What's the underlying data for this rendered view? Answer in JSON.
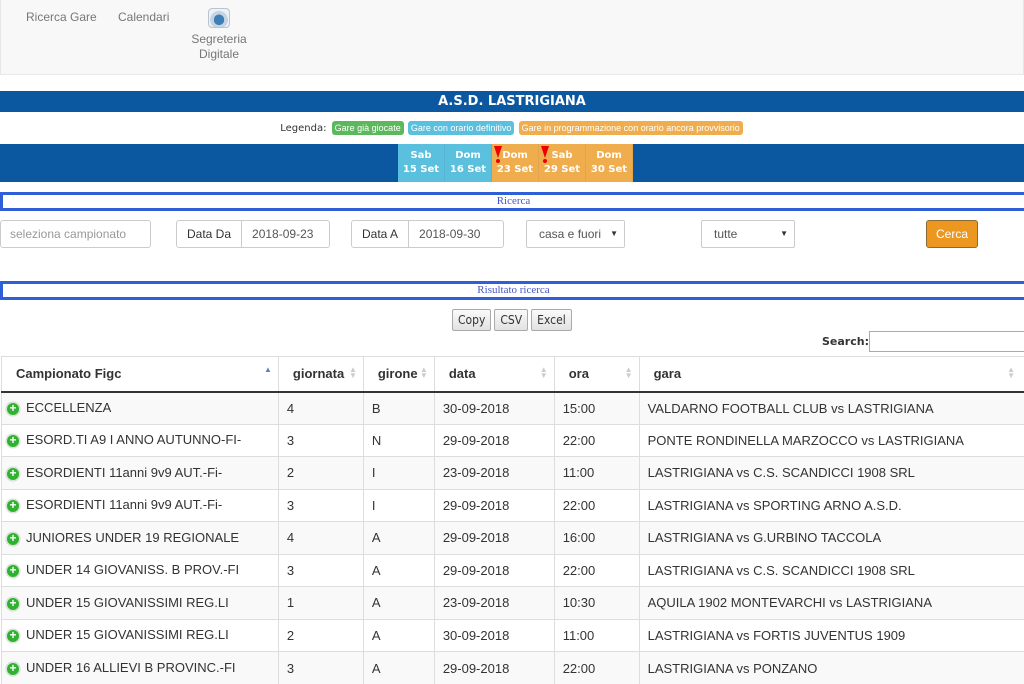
{
  "nav": {
    "ricerca_gare": "Ricerca Gare",
    "calendari": "Calendari",
    "segreteria_line1": "Segreteria",
    "segreteria_line2": "Digitale"
  },
  "title": "A.S.D. LASTRIGIANA",
  "legend": {
    "label": "Legenda:",
    "played": "Gare già giocate",
    "definitive": "Gare con orario definitivo",
    "provisional": "Gare in programmazione con orario ancora provvisorio",
    "colors": {
      "played": "#5cb85c",
      "definitive": "#5bc0de",
      "provisional": "#f0ad4e"
    }
  },
  "days": [
    {
      "day": "Sab",
      "date": "15 Set",
      "status": "definitive",
      "warning": false
    },
    {
      "day": "Dom",
      "date": "16 Set",
      "status": "definitive",
      "warning": false
    },
    {
      "day": "Dom",
      "date": "23 Set",
      "status": "provisional",
      "warning": true
    },
    {
      "day": "Sab",
      "date": "29 Set",
      "status": "provisional",
      "warning": true
    },
    {
      "day": "Dom",
      "date": "30 Set",
      "status": "provisional",
      "warning": false
    }
  ],
  "search": {
    "section_title": "Ricerca",
    "campionato_placeholder": "seleziona campionato",
    "data_da_label": "Data Da",
    "data_da_value": "2018-09-23",
    "data_a_label": "Data A",
    "data_a_value": "2018-09-30",
    "location_select": "casa e fuori",
    "type_select": "tutte",
    "submit": "Cerca"
  },
  "results": {
    "section_title": "Risultato ricerca",
    "export_buttons": [
      "Copy",
      "CSV",
      "Excel"
    ],
    "search_label": "Search:",
    "search_value": "",
    "columns": [
      "Campionato Figc",
      "giornata",
      "girone",
      "data",
      "ora",
      "gara"
    ],
    "rows": [
      [
        "ECCELLENZA",
        "4",
        "B",
        "30-09-2018",
        "15:00",
        "VALDARNO FOOTBALL CLUB vs LASTRIGIANA"
      ],
      [
        "ESORD.TI A9 I ANNO AUTUNNO-FI-",
        "3",
        "N",
        "29-09-2018",
        "22:00",
        "PONTE RONDINELLA MARZOCCO vs LASTRIGIANA"
      ],
      [
        "ESORDIENTI 11anni 9v9 AUT.-Fi-",
        "2",
        "I",
        "23-09-2018",
        "11:00",
        "LASTRIGIANA vs C.S. SCANDICCI 1908 SRL"
      ],
      [
        "ESORDIENTI 11anni 9v9 AUT.-Fi-",
        "3",
        "I",
        "29-09-2018",
        "22:00",
        "LASTRIGIANA vs SPORTING ARNO A.S.D."
      ],
      [
        "JUNIORES UNDER 19 REGIONALE",
        "4",
        "A",
        "29-09-2018",
        "16:00",
        "LASTRIGIANA vs G.URBINO TACCOLA"
      ],
      [
        "UNDER 14 GIOVANISS. B PROV.-FI",
        "3",
        "A",
        "29-09-2018",
        "22:00",
        "LASTRIGIANA vs C.S. SCANDICCI 1908 SRL"
      ],
      [
        "UNDER 15 GIOVANISSIMI REG.LI",
        "1",
        "A",
        "23-09-2018",
        "10:30",
        "AQUILA 1902 MONTEVARCHI vs LASTRIGIANA"
      ],
      [
        "UNDER 15 GIOVANISSIMI REG.LI",
        "2",
        "A",
        "30-09-2018",
        "11:00",
        "LASTRIGIANA vs FORTIS JUVENTUS 1909"
      ],
      [
        "UNDER 16 ALLIEVI B PROVINC.-FI",
        "3",
        "A",
        "29-09-2018",
        "22:00",
        "LASTRIGIANA vs PONZANO"
      ]
    ]
  }
}
